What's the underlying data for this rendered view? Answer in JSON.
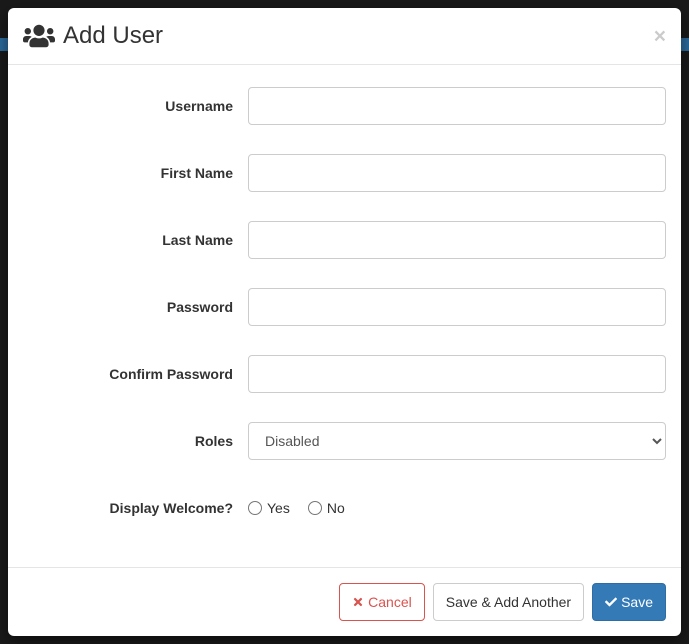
{
  "modal": {
    "title": "Add User",
    "close_label": "×"
  },
  "form": {
    "username_label": "Username",
    "firstname_label": "First Name",
    "lastname_label": "Last Name",
    "password_label": "Password",
    "confirm_password_label": "Confirm Password",
    "roles_label": "Roles",
    "roles_selected": "Disabled",
    "display_welcome_label": "Display Welcome?",
    "yes_label": "Yes",
    "no_label": "No",
    "username_value": "",
    "firstname_value": "",
    "lastname_value": "",
    "password_value": "",
    "confirm_password_value": ""
  },
  "footer": {
    "cancel_label": "Cancel",
    "save_another_label": "Save & Add Another",
    "save_label": "Save"
  }
}
